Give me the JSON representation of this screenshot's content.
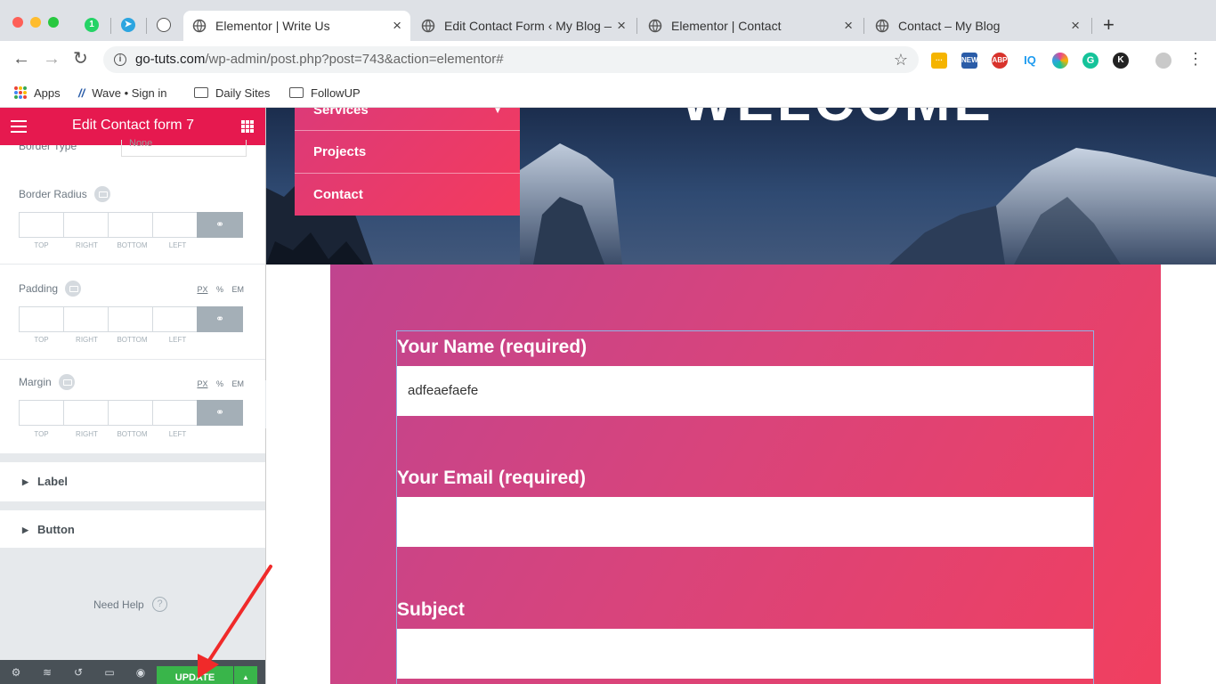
{
  "browser": {
    "pinned_tabs": [
      {
        "icon": "whatsapp-icon",
        "label": "1",
        "color": "#25d366"
      },
      {
        "icon": "telegram-icon",
        "label": "",
        "color": "#2ca5e0"
      },
      {
        "icon": "globe-icon",
        "label": "",
        "color": "#555555"
      }
    ],
    "tabs": [
      {
        "title": "Elementor | Write Us",
        "active": true
      },
      {
        "title": "Edit Contact Form ‹ My Blog —",
        "active": false
      },
      {
        "title": "Elementor | Contact",
        "active": false
      },
      {
        "title": "Contact – My Blog",
        "active": false
      }
    ],
    "new_tab": "+",
    "address": {
      "host": "go-tuts.com",
      "path": "/wp-admin/post.php?post=743&action=elementor#"
    },
    "extensions": [
      {
        "name": "notes-extension-icon",
        "label": "···",
        "color": "#f5b400"
      },
      {
        "name": "new-extension-icon",
        "label": "NEW",
        "color": "#2a5ca8"
      },
      {
        "name": "adblock-plus-icon",
        "label": "ABP",
        "color": "#d8332c"
      },
      {
        "name": "iq-extension-icon",
        "label": "IQ",
        "color": "#1d9bf0"
      },
      {
        "name": "color-picker-icon",
        "label": "",
        "color": "#e84393"
      },
      {
        "name": "grammarly-icon",
        "label": "G",
        "color": "#15c39a"
      },
      {
        "name": "k-extension-icon",
        "label": "K",
        "color": "#222222"
      }
    ],
    "bookmarks": [
      {
        "label": "Apps",
        "icon": "apps-grid-icon"
      },
      {
        "label": "Wave • Sign in",
        "icon": "wave-icon"
      },
      {
        "label": "Daily Sites",
        "icon": "folder-icon"
      },
      {
        "label": "FollowUP",
        "icon": "folder-icon"
      }
    ]
  },
  "panel": {
    "title": "Edit Contact form 7",
    "cut_label": "Border Type",
    "cut_select": "None",
    "controls": [
      {
        "label": "Border Radius",
        "show_units": false
      },
      {
        "label": "Padding",
        "show_units": true
      },
      {
        "label": "Margin",
        "show_units": true
      }
    ],
    "units": [
      "PX",
      "%",
      "EM"
    ],
    "dim_labels": [
      "TOP",
      "RIGHT",
      "BOTTOM",
      "LEFT"
    ],
    "sections": [
      "Label",
      "Button"
    ],
    "help": "Need Help",
    "update": "UPDATE",
    "accent": "#e6194f",
    "update_color": "#39b54a"
  },
  "preview": {
    "hero_title": "WELCOME",
    "menu": [
      "Services",
      "Projects",
      "Contact"
    ],
    "form": {
      "fields": [
        {
          "label": "Your Name (required)",
          "value": "adfeaefaefe"
        },
        {
          "label": "Your Email (required)",
          "value": ""
        },
        {
          "label": "Subject",
          "value": ""
        }
      ]
    }
  }
}
